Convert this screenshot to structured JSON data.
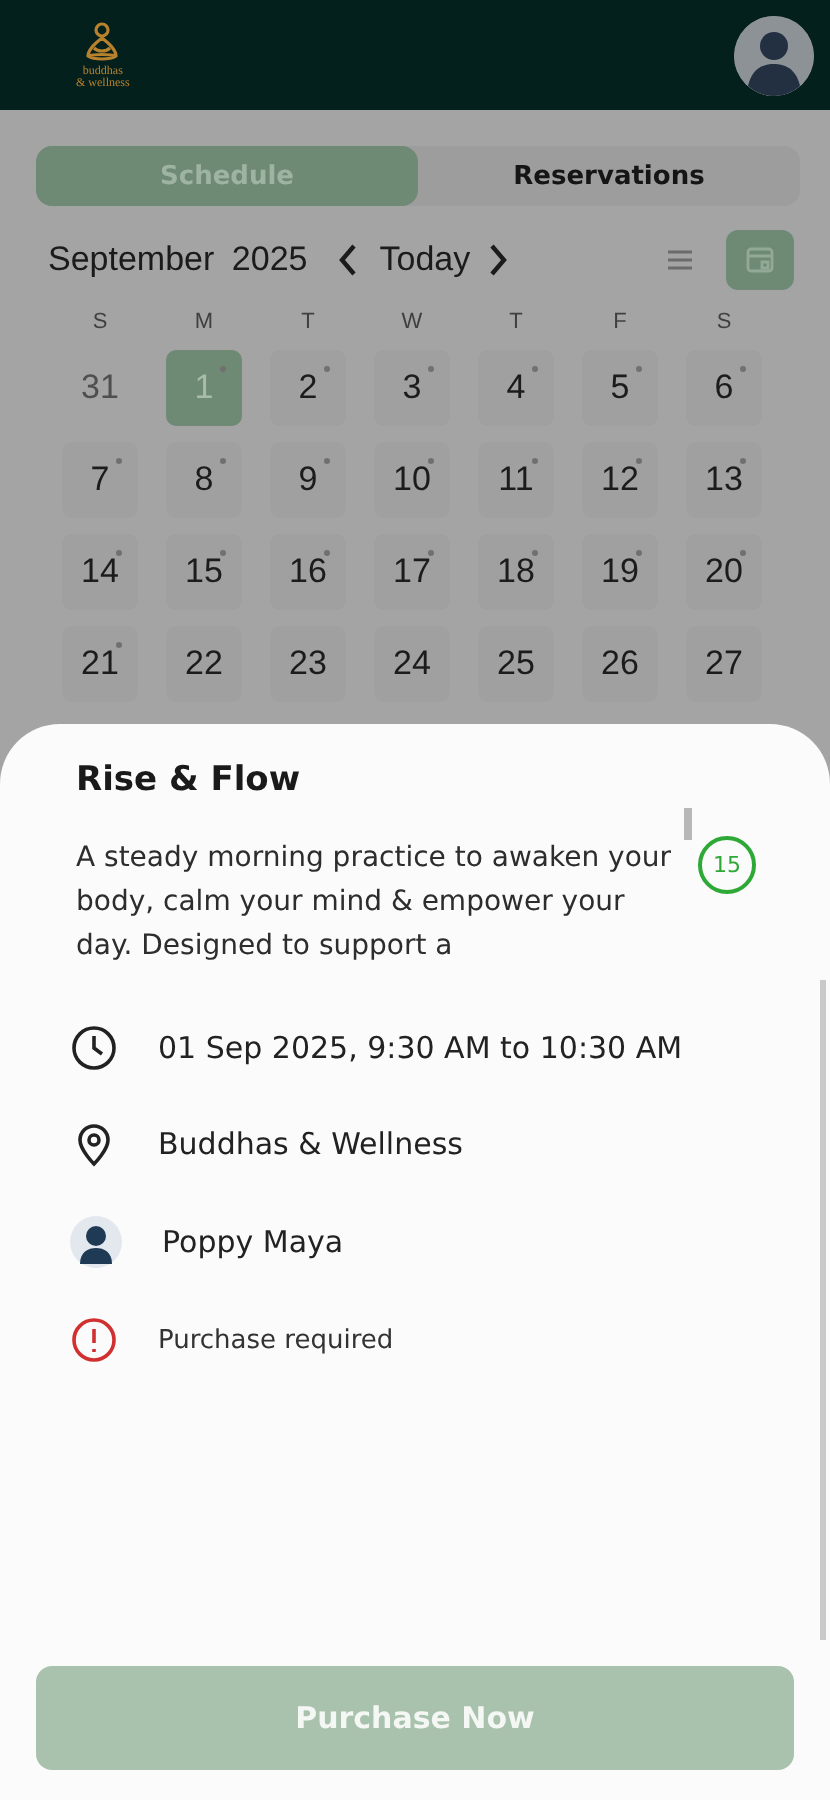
{
  "header": {
    "logo_lines": [
      "buddhas",
      "& wellness"
    ]
  },
  "tabs": [
    {
      "label": "Schedule",
      "selected": true
    },
    {
      "label": "Reservations",
      "selected": false
    }
  ],
  "calendar": {
    "month": "September",
    "year": "2025",
    "today_label": "Today",
    "views": [
      {
        "kind": "list",
        "selected": false
      },
      {
        "kind": "grid",
        "selected": true
      }
    ],
    "weekdays": [
      "S",
      "M",
      "T",
      "W",
      "T",
      "F",
      "S"
    ],
    "weeks": [
      [
        {
          "day": "31",
          "event": false,
          "selected": false,
          "muted": true
        },
        {
          "day": "1",
          "event": true,
          "selected": true,
          "muted": false
        },
        {
          "day": "2",
          "event": true,
          "selected": false,
          "muted": false
        },
        {
          "day": "3",
          "event": true,
          "selected": false,
          "muted": false
        },
        {
          "day": "4",
          "event": true,
          "selected": false,
          "muted": false
        },
        {
          "day": "5",
          "event": true,
          "selected": false,
          "muted": false
        },
        {
          "day": "6",
          "event": true,
          "selected": false,
          "muted": false
        }
      ],
      [
        {
          "day": "7",
          "event": true,
          "selected": false,
          "muted": false
        },
        {
          "day": "8",
          "event": true,
          "selected": false,
          "muted": false
        },
        {
          "day": "9",
          "event": true,
          "selected": false,
          "muted": false
        },
        {
          "day": "10",
          "event": true,
          "selected": false,
          "muted": false
        },
        {
          "day": "11",
          "event": true,
          "selected": false,
          "muted": false
        },
        {
          "day": "12",
          "event": true,
          "selected": false,
          "muted": false
        },
        {
          "day": "13",
          "event": true,
          "selected": false,
          "muted": false
        }
      ],
      [
        {
          "day": "14",
          "event": true,
          "selected": false,
          "muted": false
        },
        {
          "day": "15",
          "event": true,
          "selected": false,
          "muted": false
        },
        {
          "day": "16",
          "event": true,
          "selected": false,
          "muted": false
        },
        {
          "day": "17",
          "event": true,
          "selected": false,
          "muted": false
        },
        {
          "day": "18",
          "event": true,
          "selected": false,
          "muted": false
        },
        {
          "day": "19",
          "event": true,
          "selected": false,
          "muted": false
        },
        {
          "day": "20",
          "event": true,
          "selected": false,
          "muted": false
        }
      ],
      [
        {
          "day": "21",
          "event": true,
          "selected": false,
          "muted": false
        },
        {
          "day": "22",
          "event": false,
          "selected": false,
          "muted": false
        },
        {
          "day": "23",
          "event": false,
          "selected": false,
          "muted": false
        },
        {
          "day": "24",
          "event": false,
          "selected": false,
          "muted": false
        },
        {
          "day": "25",
          "event": false,
          "selected": false,
          "muted": false
        },
        {
          "day": "26",
          "event": false,
          "selected": false,
          "muted": false
        },
        {
          "day": "27",
          "event": false,
          "selected": false,
          "muted": false
        }
      ]
    ]
  },
  "sheet": {
    "title": "Rise & Flow",
    "description": "A steady morning practice to awaken your body, calm your mind & empower your day. Designed to support a",
    "spots_badge": "15",
    "details": [
      {
        "kind": "time",
        "text": "01 Sep 2025, 9:30 AM to 10:30 AM"
      },
      {
        "kind": "location",
        "text": "Buddhas & Wellness"
      },
      {
        "kind": "instructor",
        "text": "Poppy Maya"
      },
      {
        "kind": "warning",
        "text": "Purchase required"
      }
    ],
    "action": {
      "label": "Purchase Now",
      "disabled": true
    }
  }
}
